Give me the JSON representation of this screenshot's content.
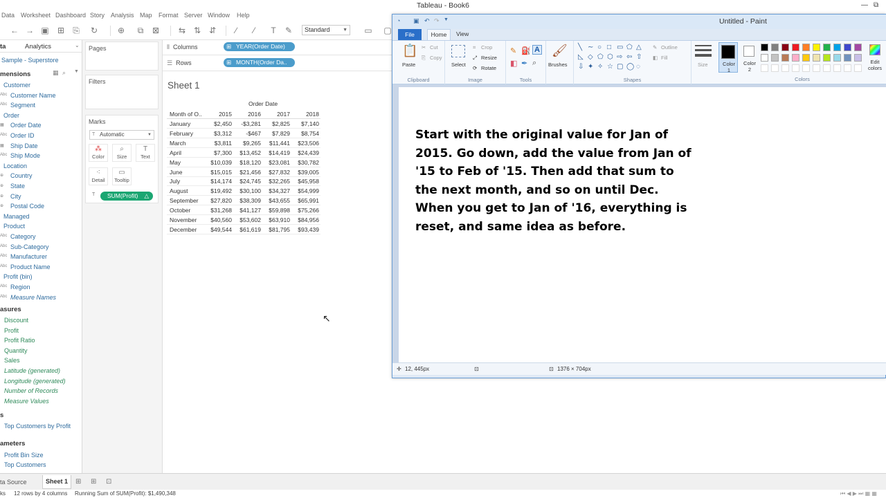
{
  "window": {
    "title": "Tableau - Book6",
    "controls": [
      "—",
      "⧉"
    ]
  },
  "menu": [
    "Data",
    "Worksheet",
    "Dashboard",
    "Story",
    "Analysis",
    "Map",
    "Format",
    "Server",
    "Window",
    "Help"
  ],
  "toolbar": {
    "fit_label": "Standard"
  },
  "data_pane": {
    "tab_data": "ta",
    "tab_analytics": "Analytics",
    "source": "Sample - Superstore",
    "dimensions_header": "mensions",
    "dimensions": [
      {
        "label": "Customer",
        "kind": "folder"
      },
      {
        "label": "Customer Name",
        "kind": "abc"
      },
      {
        "label": "Segment",
        "kind": "abc"
      },
      {
        "label": "Order",
        "kind": "folder"
      },
      {
        "label": "Order Date",
        "kind": "date"
      },
      {
        "label": "Order ID",
        "kind": "abc"
      },
      {
        "label": "Ship Date",
        "kind": "date"
      },
      {
        "label": "Ship Mode",
        "kind": "abc"
      },
      {
        "label": "Location",
        "kind": "folder"
      },
      {
        "label": "Country",
        "kind": "geo"
      },
      {
        "label": "State",
        "kind": "geo"
      },
      {
        "label": "City",
        "kind": "geo"
      },
      {
        "label": "Postal Code",
        "kind": "geo"
      },
      {
        "label": "Managed",
        "kind": "folder"
      },
      {
        "label": "Product",
        "kind": "folder"
      },
      {
        "label": "Category",
        "kind": "abc"
      },
      {
        "label": "Sub-Category",
        "kind": "abc"
      },
      {
        "label": "Manufacturer",
        "kind": "abc"
      },
      {
        "label": "Product Name",
        "kind": "abc"
      },
      {
        "label": "Profit (bin)",
        "kind": "bin"
      },
      {
        "label": "Region",
        "kind": "abc"
      },
      {
        "label": "Measure Names",
        "kind": "abc-italic"
      }
    ],
    "measures_header": "asures",
    "measures": [
      {
        "label": "Discount",
        "italic": false
      },
      {
        "label": "Profit",
        "italic": false
      },
      {
        "label": "Profit Ratio",
        "italic": false
      },
      {
        "label": "Quantity",
        "italic": false
      },
      {
        "label": "Sales",
        "italic": false
      },
      {
        "label": "Latitude (generated)",
        "italic": true
      },
      {
        "label": "Longitude (generated)",
        "italic": true
      },
      {
        "label": "Number of Records",
        "italic": true
      },
      {
        "label": "Measure Values",
        "italic": true
      }
    ],
    "sets_header": "s",
    "sets": [
      "Top Customers by Profit"
    ],
    "parameters_header": "ameters",
    "parameters": [
      "Profit Bin Size",
      "Top Customers"
    ]
  },
  "shelves": {
    "pages": "Pages",
    "filters": "Filters",
    "marks": "Marks",
    "mark_type": "Automatic",
    "mark_buttons": [
      "Color",
      "Size",
      "Text",
      "Detail",
      "Tooltip"
    ],
    "mark_pill": "SUM(Profit)",
    "columns_label": "Columns",
    "columns_pill": "YEAR(Order Date)",
    "rows_label": "Rows",
    "rows_pill": "MONTH(Order Da.."
  },
  "view": {
    "sheet_title": "Sheet 1",
    "table": {
      "column_header": "Order Date",
      "row_header": "Month of O..",
      "years": [
        "2015",
        "2016",
        "2017",
        "2018"
      ],
      "rows": [
        {
          "month": "January",
          "values": [
            "$2,450",
            "-$3,281",
            "$2,825",
            "$7,140"
          ]
        },
        {
          "month": "February",
          "values": [
            "$3,312",
            "-$467",
            "$7,829",
            "$8,754"
          ]
        },
        {
          "month": "March",
          "values": [
            "$3,811",
            "$9,265",
            "$11,441",
            "$23,506"
          ]
        },
        {
          "month": "April",
          "values": [
            "$7,300",
            "$13,452",
            "$14,419",
            "$24,439"
          ]
        },
        {
          "month": "May",
          "values": [
            "$10,039",
            "$18,120",
            "$23,081",
            "$30,782"
          ]
        },
        {
          "month": "June",
          "values": [
            "$15,015",
            "$21,456",
            "$27,832",
            "$39,005"
          ]
        },
        {
          "month": "July",
          "values": [
            "$14,174",
            "$24,745",
            "$32,265",
            "$45,958"
          ]
        },
        {
          "month": "August",
          "values": [
            "$19,492",
            "$30,100",
            "$34,327",
            "$54,999"
          ]
        },
        {
          "month": "September",
          "values": [
            "$27,820",
            "$38,309",
            "$43,655",
            "$65,991"
          ]
        },
        {
          "month": "October",
          "values": [
            "$31,268",
            "$41,127",
            "$59,898",
            "$75,266"
          ]
        },
        {
          "month": "November",
          "values": [
            "$40,560",
            "$53,602",
            "$63,910",
            "$84,956"
          ]
        },
        {
          "month": "December",
          "values": [
            "$49,544",
            "$61,619",
            "$81,795",
            "$93,439"
          ]
        }
      ]
    }
  },
  "bottom": {
    "data_source_tab": "ta Source",
    "sheet_tab": "Sheet 1",
    "status_marks": "ks",
    "status_rows": "12 rows by 4 columns",
    "status_sum": "Running Sum of SUM(Profit): $1,490,348"
  },
  "paint": {
    "title": "Untitled - Paint",
    "tab_file": "File",
    "tab_home": "Home",
    "tab_view": "View",
    "clipboard": {
      "paste": "Paste",
      "cut": "Cut",
      "copy": "Copy",
      "label": "Clipboard"
    },
    "image": {
      "select": "Select",
      "crop": "Crop",
      "resize": "Resize",
      "rotate": "Rotate",
      "label": "Image"
    },
    "tools": {
      "label": "Tools"
    },
    "brushes": "Brushes",
    "shapes": {
      "outline": "Outline",
      "fill": "Fill",
      "label": "Shapes"
    },
    "size": "Size",
    "color1": "Color 1",
    "color2": "Color 2",
    "edit_colors": "Edit colors",
    "colors_label": "Colors",
    "palette_row1": [
      "#000000",
      "#7f7f7f",
      "#880015",
      "#ed1c24",
      "#ff7f27",
      "#fff200",
      "#22b14c",
      "#00a2e8",
      "#3f48cc",
      "#a349a4"
    ],
    "palette_row2": [
      "#ffffff",
      "#c3c3c3",
      "#b97a57",
      "#ffaec9",
      "#ffc90e",
      "#efe4b0",
      "#b5e61d",
      "#99d9ea",
      "#7092be",
      "#c8bfe7"
    ],
    "canvas_text": "Start with the original value for Jan of 2015. Go down, add the value from Jan of '15 to Feb of '15. Then add that sum to the next month, and so on until Dec. When you get to Jan of '16, everything is reset, and same idea as before.",
    "status_pos": "12, 445px",
    "status_size": "1376 × 704px"
  }
}
